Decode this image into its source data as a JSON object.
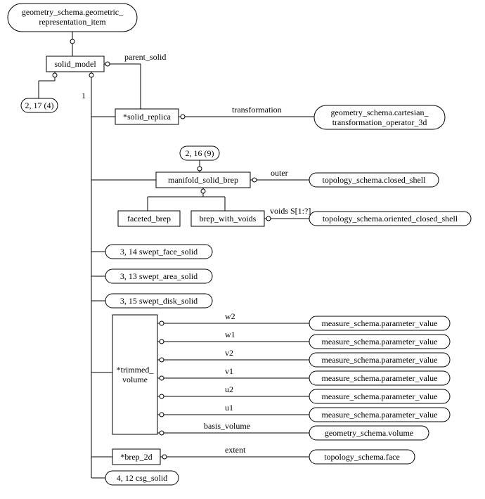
{
  "chart_data": {
    "type": "tree",
    "root": "geometry_schema.geometric_representation_item",
    "entities": [
      "solid_model",
      "solid_replica",
      "manifold_solid_brep",
      "faceted_brep",
      "brep_with_voids",
      "swept_face_solid",
      "swept_area_solid",
      "swept_disk_solid",
      "trimmed_volume",
      "brep_2d",
      "csg_solid"
    ],
    "references": {
      "solid_replica.transformation": "geometry_schema.cartesian_transformation_operator_3d",
      "solid_replica.parent_solid": "solid_model",
      "manifold_solid_brep.outer": "topology_schema.closed_shell",
      "brep_with_voids.voids": "topology_schema.oriented_closed_shell",
      "trimmed_volume.w2": "measure_schema.parameter_value",
      "trimmed_volume.w1": "measure_schema.parameter_value",
      "trimmed_volume.v2": "measure_schema.parameter_value",
      "trimmed_volume.v1": "measure_schema.parameter_value",
      "trimmed_volume.u2": "measure_schema.parameter_value",
      "trimmed_volume.u1": "measure_schema.parameter_value",
      "trimmed_volume.basis_volume": "geometry_schema.volume",
      "brep_2d.extent": "topology_schema.face"
    },
    "page_refs": {
      "solid_model": "2, 17 (4)",
      "manifold_solid_brep": "2, 16 (9)",
      "swept_face_solid": "3, 14",
      "swept_area_solid": "3, 13",
      "swept_disk_solid": "3, 15",
      "csg_solid": "4, 12"
    }
  },
  "root": {
    "l1": "geometry_schema.geometric_",
    "l2": "representation_item"
  },
  "solid_model": "solid_model",
  "pg_217": "2, 17 (4)",
  "one": "1",
  "solid_replica": "*solid_replica",
  "parent_solid": "parent_solid",
  "transformation": "transformation",
  "cartesian": {
    "l1": "geometry_schema.cartesian_",
    "l2": "transformation_operator_3d"
  },
  "pg_216": "2, 16 (9)",
  "manifold": "manifold_solid_brep",
  "outer": "outer",
  "closed_shell": "topology_schema.closed_shell",
  "faceted": "faceted_brep",
  "bwv": "brep_with_voids",
  "voids": "voids S[1:?]",
  "ocs": "topology_schema.oriented_closed_shell",
  "sfs": "3, 14 swept_face_solid",
  "sas": "3, 13 swept_area_solid",
  "sds": "3, 15 swept_disk_solid",
  "tv": {
    "l1": "*trimmed_",
    "l2": "volume"
  },
  "w2": "w2",
  "w1": "w1",
  "v2": "v2",
  "v1": "v1",
  "u2": "u2",
  "u1": "u1",
  "basis_volume": "basis_volume",
  "mspv": "measure_schema.parameter_value",
  "gsv": "geometry_schema.volume",
  "brep2d": "*brep_2d",
  "extent": "extent",
  "tsf": "topology_schema.face",
  "csg": "4, 12 csg_solid"
}
